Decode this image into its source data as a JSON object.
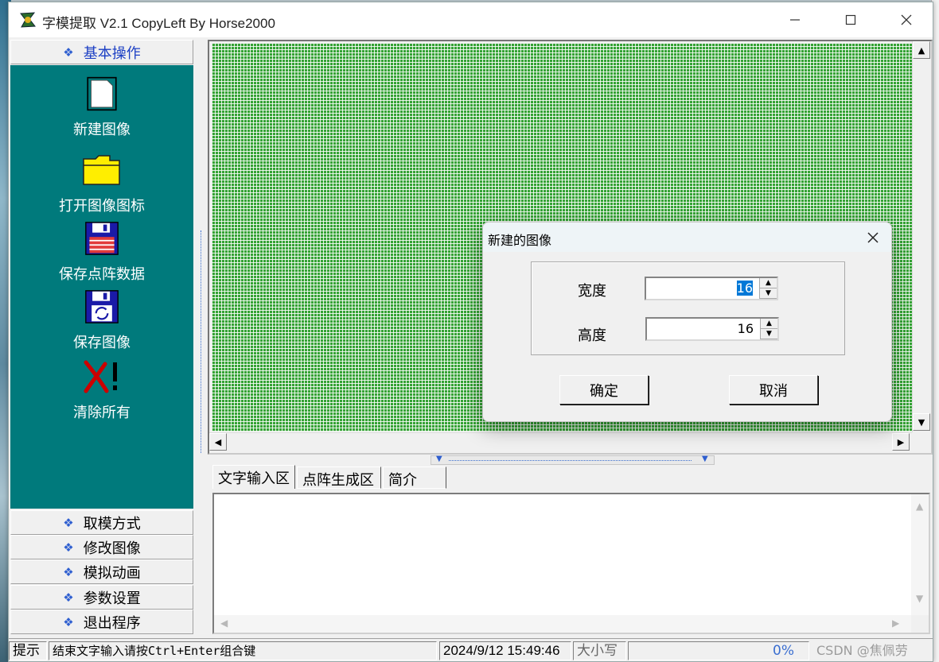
{
  "window": {
    "title": "字模提取 V2.1  CopyLeft By Horse2000"
  },
  "caption_buttons": {
    "minimize": "—",
    "maximize": "☐",
    "close": "✕"
  },
  "nav": {
    "basic": "基本操作",
    "sections": [
      "取模方式",
      "修改图像",
      "模拟动画",
      "参数设置",
      "退出程序"
    ]
  },
  "tools": [
    {
      "label": "新建图像",
      "icon": "new-file-icon"
    },
    {
      "label": "打开图像图标",
      "icon": "folder-icon"
    },
    {
      "label": "保存点阵数据",
      "icon": "floppy-icon"
    },
    {
      "label": "保存图像",
      "icon": "floppy-refresh-icon"
    },
    {
      "label": "清除所有",
      "icon": "clear-all-icon"
    }
  ],
  "tabs": [
    "文字输入区",
    "点阵生成区",
    "简介"
  ],
  "status": {
    "hint": "提示",
    "message": "结束文字输入请按Ctrl+Enter组合键",
    "time": "2024/9/12 15:49:46",
    "caps": "大小写",
    "percent": "0%"
  },
  "dialog": {
    "title": "新建的图像",
    "width_label": "宽度",
    "width_value": "16",
    "height_label": "高度",
    "height_value": "16",
    "ok": "确定",
    "cancel": "取消"
  },
  "watermark": "CSDN @焦佩劳",
  "colors": {
    "grid": "#34a234",
    "panel": "#007a7c",
    "accent": "#1c3fc4"
  }
}
